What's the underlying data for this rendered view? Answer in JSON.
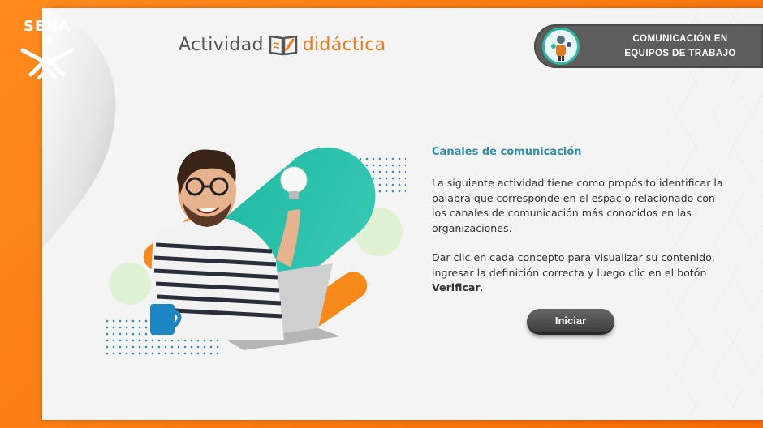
{
  "brand": {
    "logo_text": "SENA"
  },
  "header": {
    "activity_word": "Actividad",
    "activity_word_2": "didáctica",
    "topic_line_1": "COMUNICACIÓN EN",
    "topic_line_2": "EQUIPOS DE TRABAJO"
  },
  "content": {
    "title": "Canales de comunicación",
    "paragraph_1": "La siguiente actividad tiene como propósito identificar la palabra que corresponde en el espacio relacionado con los canales de comunicación más conocidos en las organizaciones.",
    "paragraph_2_prefix": "Dar clic en cada concepto para visualizar su contenido, ingresar la definición correcta y luego clic en el botón ",
    "paragraph_2_bold": "Verificar",
    "paragraph_2_suffix": "."
  },
  "actions": {
    "start_label": "Iniciar"
  },
  "colors": {
    "orange": "#f47a14",
    "teal": "#2bb9a5",
    "dark_gray": "#5d5d5d",
    "title_blue": "#2f8fa5"
  },
  "icons": {
    "book": "book-icon",
    "avatar": "team-avatar-icon"
  }
}
